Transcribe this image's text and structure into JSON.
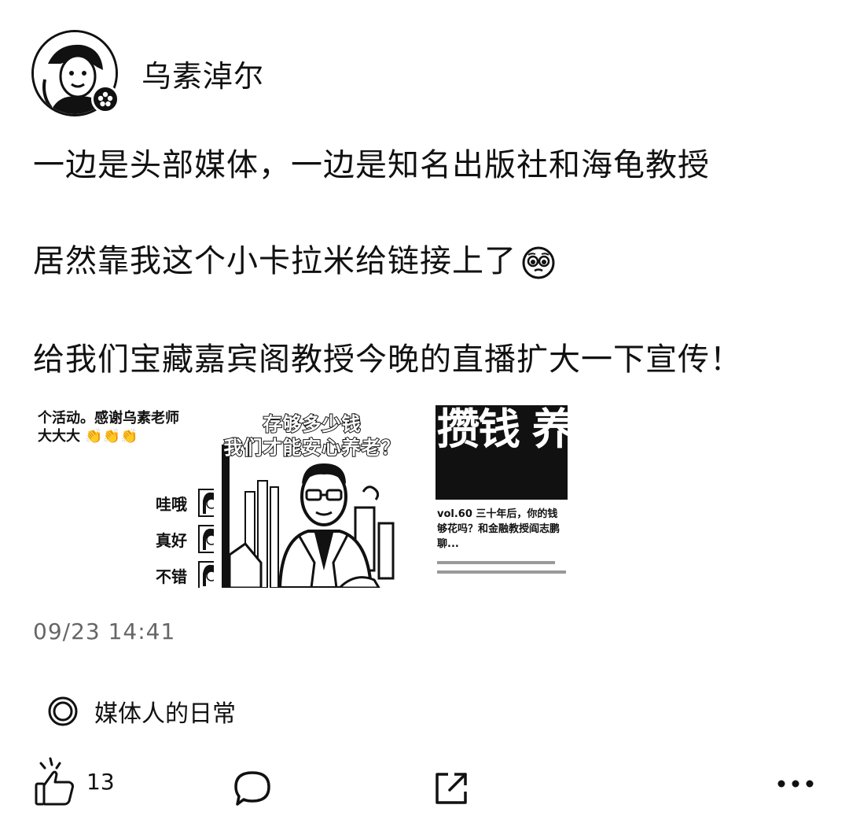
{
  "post": {
    "author": "乌素淖尔",
    "lines": [
      "一边是头部媒体，一边是知名出版社和海龟教授",
      "居然靠我这个小卡拉米给链接上了",
      "给我们宝藏嘉宾阁教授今晚的直播扩大一下宣传！"
    ],
    "images": {
      "first": {
        "text_lines": [
          "个活动。感谢乌素老师",
          "大大大 👏👏👏"
        ],
        "comments": [
          "哇哦",
          "真好",
          "不错"
        ]
      },
      "second": {
        "title_lines": [
          "存够多少钱",
          "我们才能安心养老？"
        ]
      },
      "third": {
        "big_text": "攒钱 养老",
        "caption": "vol.60 三十年后，你的钱够花吗？和金融教授阎志鹏聊..."
      }
    },
    "timestamp": "09/23 14:41",
    "topic": "媒体人的日常",
    "likes": "13"
  },
  "icons": {
    "avatar_badge": "flower-icon",
    "emoji": "pleading-face-icon",
    "topic": "topic-circle-icon",
    "like": "thumbs-up-icon",
    "comment": "comment-bubble-icon",
    "share": "share-icon",
    "more": "more-dots-icon"
  }
}
